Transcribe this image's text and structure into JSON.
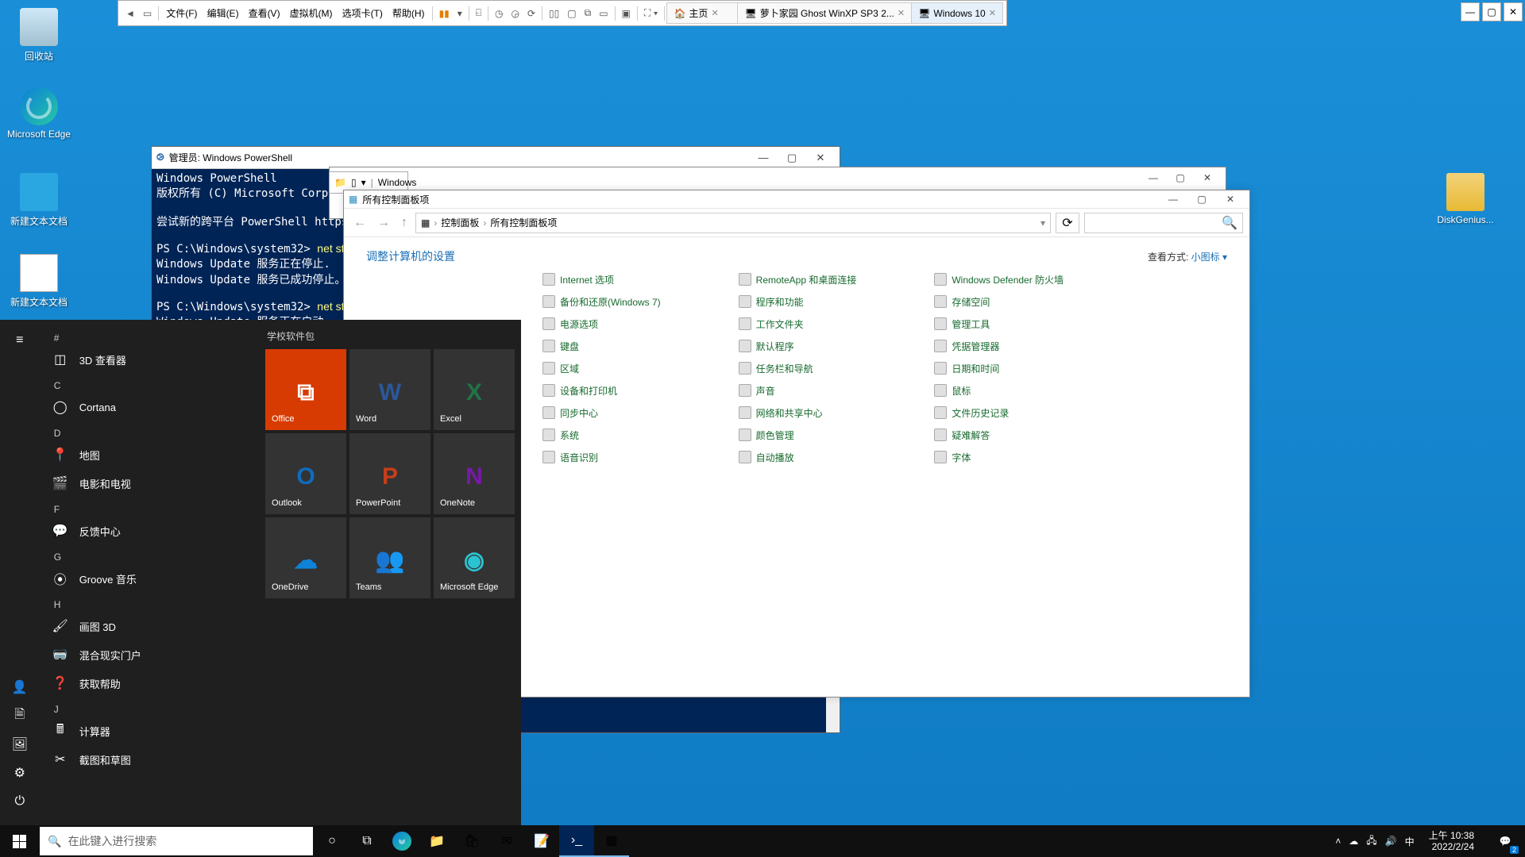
{
  "vmMenu": {
    "file": "文件(F)",
    "edit": "编辑(E)",
    "view": "查看(V)",
    "vm": "虚拟机(M)",
    "tabs": "选项卡(T)",
    "help": "帮助(H)"
  },
  "vmTabs": [
    {
      "label": "主页",
      "home": true
    },
    {
      "label": "萝卜家园 Ghost WinXP SP3 2..."
    },
    {
      "label": "Windows 10",
      "active": true
    }
  ],
  "desktop": {
    "recycle": "回收站",
    "edge": "Microsoft Edge",
    "newtxt": "新建文本文档",
    "diskgenius": "DiskGenius..."
  },
  "powershell": {
    "title": "管理员: Windows PowerShell",
    "lines": "Windows PowerShell\n版权所有 (C) Microsoft Corporat\n\n尝试新的跨平台 PowerShell https\n\nPS C:\\Windows\\system32> <y>net sto</y>\nWindows Update 服务正在停止.\nWindows Update 服务已成功停止。\n\nPS C:\\Windows\\system32> <y>net sta</y>\nWindows Update 服务正在启动 .\nWindows Update 服务已经启动成功"
  },
  "explorer": {
    "qat_title": "Windows"
  },
  "controlPanel": {
    "title": "所有控制面板项",
    "crumb1": "控制面板",
    "crumb2": "所有控制面板项",
    "heading": "调整计算机的设置",
    "viewLabel": "查看方式:",
    "viewValue": "小图标 ▾",
    "items": [
      [
        "Internet 选项",
        "RemoteApp 和桌面连接",
        "Windows Defender 防火墙"
      ],
      [
        "备份和还原(Windows 7)",
        "程序和功能",
        "存储空间"
      ],
      [
        "电源选项",
        "工作文件夹",
        "管理工具"
      ],
      [
        "键盘",
        "默认程序",
        "凭据管理器"
      ],
      [
        "区域",
        "任务栏和导航",
        "日期和时间"
      ],
      [
        "设备和打印机",
        "声音",
        "鼠标"
      ],
      [
        "同步中心",
        "网络和共享中心",
        "文件历史记录"
      ],
      [
        "系统",
        "颜色管理",
        "疑难解答"
      ],
      [
        "语音识别",
        "自动播放",
        "字体"
      ]
    ]
  },
  "startMenu": {
    "tilesHeader": "学校软件包",
    "tiles": [
      [
        "Office",
        "Word",
        "Excel"
      ],
      [
        "Outlook",
        "PowerPoint",
        "OneNote"
      ],
      [
        "OneDrive",
        "Teams",
        "Microsoft Edge"
      ]
    ],
    "apps": [
      {
        "letter": "#"
      },
      {
        "icon": "cube",
        "label": "3D 查看器"
      },
      {
        "letter": "C"
      },
      {
        "icon": "ring",
        "label": "Cortana"
      },
      {
        "letter": "D"
      },
      {
        "icon": "map",
        "label": "地图"
      },
      {
        "icon": "film",
        "label": "电影和电视"
      },
      {
        "letter": "F"
      },
      {
        "icon": "feedback",
        "label": "反馈中心"
      },
      {
        "letter": "G"
      },
      {
        "icon": "groove",
        "label": "Groove 音乐"
      },
      {
        "letter": "H"
      },
      {
        "icon": "paint",
        "label": "画图 3D"
      },
      {
        "icon": "mr",
        "label": "混合现实门户"
      },
      {
        "icon": "help",
        "label": "获取帮助"
      },
      {
        "letter": "J"
      },
      {
        "icon": "calc",
        "label": "计算器"
      },
      {
        "icon": "snip",
        "label": "截图和草图"
      }
    ]
  },
  "taskbar": {
    "searchPlaceholder": "在此键入进行搜索",
    "ime": "中",
    "time": "上午 10:38",
    "date": "2022/2/24",
    "notif": "2"
  }
}
